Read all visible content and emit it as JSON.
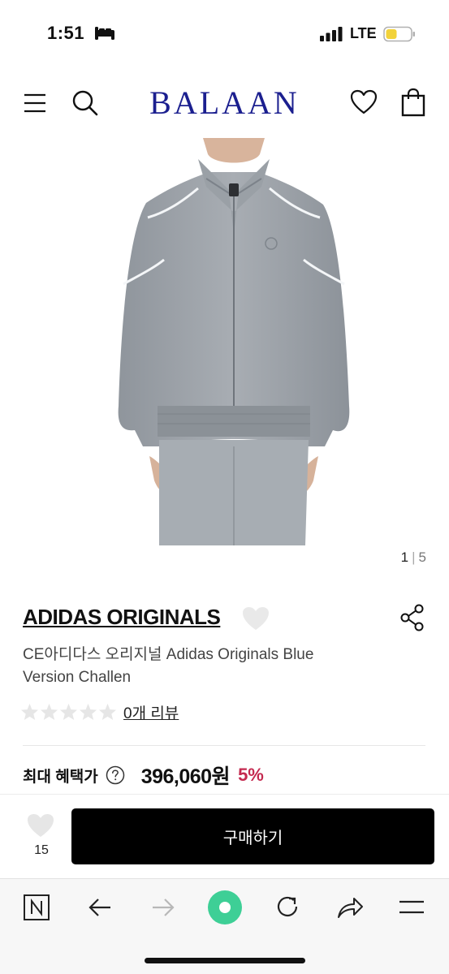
{
  "status_bar": {
    "time": "1:51",
    "network": "LTE"
  },
  "header": {
    "logo": "BALAAN"
  },
  "gallery": {
    "current": "1",
    "separator": "|",
    "total": "5"
  },
  "product": {
    "brand": "ADIDAS ORIGINALS",
    "name": "CE아디다스 오리지널 Adidas Originals Blue Version Challen",
    "rating": 0,
    "review_link": "0개 리뷰",
    "benefit_label": "최대 혜택가",
    "price": "396,060원",
    "discount": "5%"
  },
  "action_bar": {
    "like_count": "15",
    "buy_label": "구매하기"
  },
  "icons": [
    "sleep-icon",
    "signal-icon",
    "battery-icon",
    "menu-icon",
    "search-icon",
    "heart-icon",
    "bag-icon",
    "share-icon",
    "star-icon",
    "help-icon",
    "tab-icon",
    "back-arrow-icon",
    "forward-arrow-icon",
    "home-icon",
    "reload-icon",
    "share-arrow-icon",
    "hamburger-icon"
  ],
  "colors": {
    "logo": "#1b1f8f",
    "discount": "#c4294f",
    "buy_button": "#000000",
    "home_icon": "#3ecf96",
    "battery": "#f2d23a"
  }
}
